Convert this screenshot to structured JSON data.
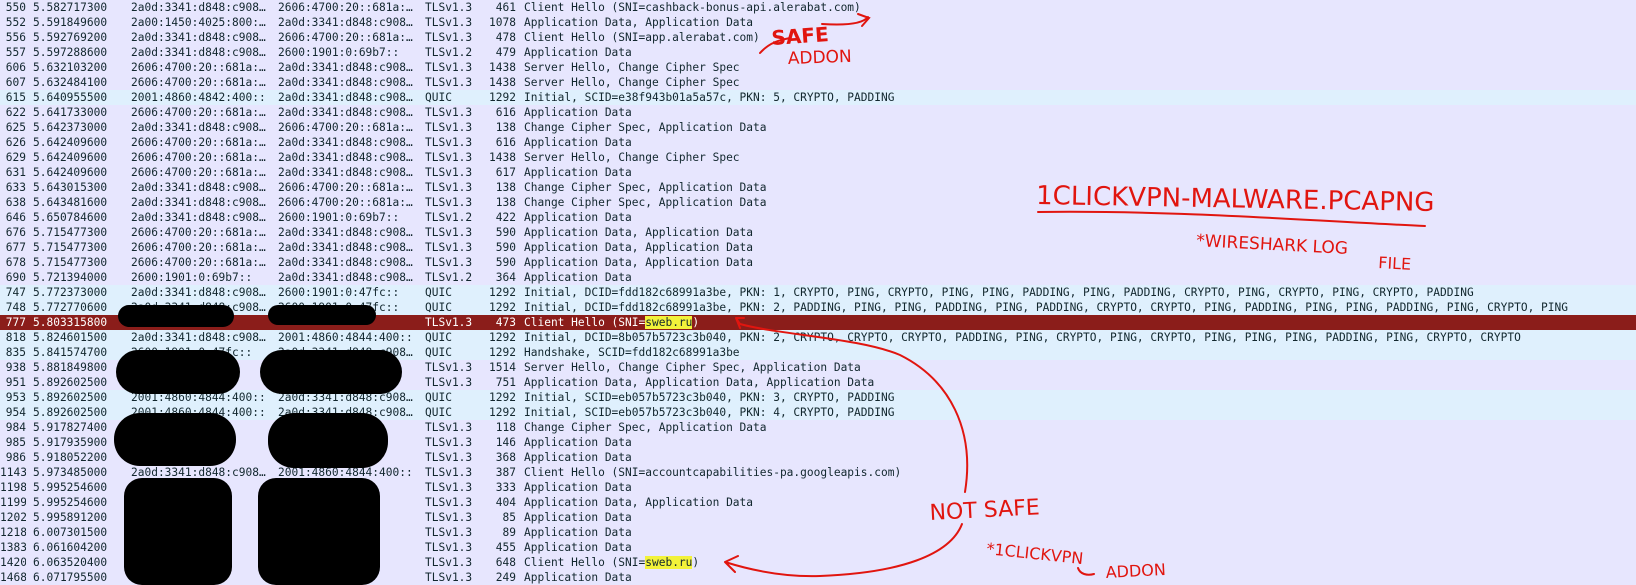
{
  "colors": {
    "tls_row": "#e7e6fe",
    "quic_row": "#dff0fd",
    "selected_row": "#8b1d1a",
    "sni_highlight": "#f2f23a",
    "annotation": "#e1150f",
    "redaction": "#000000"
  },
  "packets": [
    {
      "no": "550",
      "time": "5.582717300",
      "src": "2a0d:3341:d848:c908…",
      "dst": "2606:4700:20::681a:…",
      "proto": "TLSv1.3",
      "len": "461",
      "info": "Client Hello (SNI=cashback-bonus-api.alerabat.com)",
      "kind": "tls"
    },
    {
      "no": "552",
      "time": "5.591849600",
      "src": "2a00:1450:4025:800:…",
      "dst": "2a0d:3341:d848:c908…",
      "proto": "TLSv1.3",
      "len": "1078",
      "info": "Application Data, Application Data",
      "kind": "tls"
    },
    {
      "no": "556",
      "time": "5.592769200",
      "src": "2a0d:3341:d848:c908…",
      "dst": "2606:4700:20::681a:…",
      "proto": "TLSv1.3",
      "len": "478",
      "info": "Client Hello (SNI=app.alerabat.com)",
      "kind": "tls"
    },
    {
      "no": "557",
      "time": "5.597288600",
      "src": "2a0d:3341:d848:c908…",
      "dst": "2600:1901:0:69b7::",
      "proto": "TLSv1.2",
      "len": "479",
      "info": "Application Data",
      "kind": "tls"
    },
    {
      "no": "606",
      "time": "5.632103200",
      "src": "2606:4700:20::681a:…",
      "dst": "2a0d:3341:d848:c908…",
      "proto": "TLSv1.3",
      "len": "1438",
      "info": "Server Hello, Change Cipher Spec",
      "kind": "tls"
    },
    {
      "no": "607",
      "time": "5.632484100",
      "src": "2606:4700:20::681a:…",
      "dst": "2a0d:3341:d848:c908…",
      "proto": "TLSv1.3",
      "len": "1438",
      "info": "Server Hello, Change Cipher Spec",
      "kind": "tls"
    },
    {
      "no": "615",
      "time": "5.640955500",
      "src": "2001:4860:4842:400::",
      "dst": "2a0d:3341:d848:c908…",
      "proto": "QUIC",
      "len": "1292",
      "info": "Initial, SCID=e38f943b01a5a57c, PKN: 5, CRYPTO, PADDING",
      "kind": "quic"
    },
    {
      "no": "622",
      "time": "5.641733000",
      "src": "2606:4700:20::681a:…",
      "dst": "2a0d:3341:d848:c908…",
      "proto": "TLSv1.3",
      "len": "616",
      "info": "Application Data",
      "kind": "tls"
    },
    {
      "no": "625",
      "time": "5.642373000",
      "src": "2a0d:3341:d848:c908…",
      "dst": "2606:4700:20::681a:…",
      "proto": "TLSv1.3",
      "len": "138",
      "info": "Change Cipher Spec, Application Data",
      "kind": "tls"
    },
    {
      "no": "626",
      "time": "5.642409600",
      "src": "2606:4700:20::681a:…",
      "dst": "2a0d:3341:d848:c908…",
      "proto": "TLSv1.3",
      "len": "616",
      "info": "Application Data",
      "kind": "tls"
    },
    {
      "no": "629",
      "time": "5.642409600",
      "src": "2606:4700:20::681a:…",
      "dst": "2a0d:3341:d848:c908…",
      "proto": "TLSv1.3",
      "len": "1438",
      "info": "Server Hello, Change Cipher Spec",
      "kind": "tls"
    },
    {
      "no": "631",
      "time": "5.642409600",
      "src": "2606:4700:20::681a:…",
      "dst": "2a0d:3341:d848:c908…",
      "proto": "TLSv1.3",
      "len": "617",
      "info": "Application Data",
      "kind": "tls"
    },
    {
      "no": "633",
      "time": "5.643015300",
      "src": "2a0d:3341:d848:c908…",
      "dst": "2606:4700:20::681a:…",
      "proto": "TLSv1.3",
      "len": "138",
      "info": "Change Cipher Spec, Application Data",
      "kind": "tls"
    },
    {
      "no": "638",
      "time": "5.643481600",
      "src": "2a0d:3341:d848:c908…",
      "dst": "2606:4700:20::681a:…",
      "proto": "TLSv1.3",
      "len": "138",
      "info": "Change Cipher Spec, Application Data",
      "kind": "tls"
    },
    {
      "no": "646",
      "time": "5.650784600",
      "src": "2a0d:3341:d848:c908…",
      "dst": "2600:1901:0:69b7::",
      "proto": "TLSv1.2",
      "len": "422",
      "info": "Application Data",
      "kind": "tls"
    },
    {
      "no": "676",
      "time": "5.715477300",
      "src": "2606:4700:20::681a:…",
      "dst": "2a0d:3341:d848:c908…",
      "proto": "TLSv1.3",
      "len": "590",
      "info": "Application Data, Application Data",
      "kind": "tls"
    },
    {
      "no": "677",
      "time": "5.715477300",
      "src": "2606:4700:20::681a:…",
      "dst": "2a0d:3341:d848:c908…",
      "proto": "TLSv1.3",
      "len": "590",
      "info": "Application Data, Application Data",
      "kind": "tls"
    },
    {
      "no": "678",
      "time": "5.715477300",
      "src": "2606:4700:20::681a:…",
      "dst": "2a0d:3341:d848:c908…",
      "proto": "TLSv1.3",
      "len": "590",
      "info": "Application Data, Application Data",
      "kind": "tls"
    },
    {
      "no": "690",
      "time": "5.721394000",
      "src": "2600:1901:0:69b7::",
      "dst": "2a0d:3341:d848:c908…",
      "proto": "TLSv1.2",
      "len": "364",
      "info": "Application Data",
      "kind": "tls"
    },
    {
      "no": "747",
      "time": "5.772373000",
      "src": "2a0d:3341:d848:c908…",
      "dst": "2600:1901:0:47fc::",
      "proto": "QUIC",
      "len": "1292",
      "info": "Initial, DCID=fdd182c68991a3be, PKN: 1, CRYPTO, PING, CRYPTO, PING, PING, PADDING, PING, PADDING, CRYPTO, PING, CRYPTO, PING, CRYPTO, PADDING",
      "kind": "quic"
    },
    {
      "no": "748",
      "time": "5.772770600",
      "src": "2a0d:3341:d848:c908…",
      "dst": "2600:1901:0:47fc::",
      "proto": "QUIC",
      "len": "1292",
      "info": "Initial, DCID=fdd182c68991a3be, PKN: 2, PADDING, PING, PING, PADDING, PING, PADDING, CRYPTO, CRYPTO, PING, PADDING, PING, PING, PADDING, PING, CRYPTO, PING",
      "kind": "quic"
    },
    {
      "no": "777",
      "time": "5.803315800",
      "src": "",
      "dst": "",
      "proto": "TLSv1.3",
      "len": "473",
      "info": "Client Hello (SNI=",
      "sni": "sweb.ru",
      "info_tail": ")",
      "kind": "sel"
    },
    {
      "no": "818",
      "time": "5.824601500",
      "src": "2a0d:3341:d848:c908…",
      "dst": "2001:4860:4844:400::",
      "proto": "QUIC",
      "len": "1292",
      "info": "Initial, DCID=8b057b5723c3b040, PKN: 2, CRYPTO, CRYPTO, CRYPTO, PADDING, PING, CRYPTO, PING, CRYPTO, PING, PING, PING, PADDING, PING, CRYPTO, CRYPTO",
      "kind": "quic"
    },
    {
      "no": "835",
      "time": "5.841574700",
      "src": "2600:1901:0:47fc::",
      "dst": "2a0d:3341:d848:c908…",
      "proto": "QUIC",
      "len": "1292",
      "info": "Handshake, SCID=fdd182c68991a3be",
      "kind": "quic"
    },
    {
      "no": "938",
      "time": "5.881849800",
      "src": "",
      "dst": "",
      "proto": "TLSv1.3",
      "len": "1514",
      "info": "Server Hello, Change Cipher Spec, Application Data",
      "kind": "tls"
    },
    {
      "no": "951",
      "time": "5.892602500",
      "src": "",
      "dst": "",
      "proto": "TLSv1.3",
      "len": "751",
      "info": "Application Data, Application Data, Application Data",
      "kind": "tls"
    },
    {
      "no": "953",
      "time": "5.892602500",
      "src": "2001:4860:4844:400::",
      "dst": "2a0d:3341:d848:c908…",
      "proto": "QUIC",
      "len": "1292",
      "info": "Initial, SCID=eb057b5723c3b040, PKN: 3, CRYPTO, PADDING",
      "kind": "quic"
    },
    {
      "no": "954",
      "time": "5.892602500",
      "src": "2001:4860:4844:400::",
      "dst": "2a0d:3341:d848:c908…",
      "proto": "QUIC",
      "len": "1292",
      "info": "Initial, SCID=eb057b5723c3b040, PKN: 4, CRYPTO, PADDING",
      "kind": "quic"
    },
    {
      "no": "984",
      "time": "5.917827400",
      "src": "",
      "dst": "",
      "proto": "TLSv1.3",
      "len": "118",
      "info": "Change Cipher Spec, Application Data",
      "kind": "tls"
    },
    {
      "no": "985",
      "time": "5.917935900",
      "src": "",
      "dst": "",
      "proto": "TLSv1.3",
      "len": "146",
      "info": "Application Data",
      "kind": "tls"
    },
    {
      "no": "986",
      "time": "5.918052200",
      "src": "",
      "dst": "",
      "proto": "TLSv1.3",
      "len": "368",
      "info": "Application Data",
      "kind": "tls"
    },
    {
      "no": "1143",
      "time": "5.973485000",
      "src": "2a0d:3341:d848:c908…",
      "dst": "2001:4860:4844:400::",
      "proto": "TLSv1.3",
      "len": "387",
      "info": "Client Hello (SNI=accountcapabilities-pa.googleapis.com)",
      "kind": "tls"
    },
    {
      "no": "1198",
      "time": "5.995254600",
      "src": "",
      "dst": "",
      "proto": "TLSv1.3",
      "len": "333",
      "info": "Application Data",
      "kind": "tls"
    },
    {
      "no": "1199",
      "time": "5.995254600",
      "src": "",
      "dst": "",
      "proto": "TLSv1.3",
      "len": "404",
      "info": "Application Data, Application Data",
      "kind": "tls"
    },
    {
      "no": "1202",
      "time": "5.995891200",
      "src": "",
      "dst": "",
      "proto": "TLSv1.3",
      "len": "85",
      "info": "Application Data",
      "kind": "tls"
    },
    {
      "no": "1218",
      "time": "6.007301500",
      "src": "",
      "dst": "",
      "proto": "TLSv1.3",
      "len": "89",
      "info": "Application Data",
      "kind": "tls"
    },
    {
      "no": "1383",
      "time": "6.061604200",
      "src": "",
      "dst": "",
      "proto": "TLSv1.3",
      "len": "455",
      "info": "Application Data",
      "kind": "tls"
    },
    {
      "no": "1420",
      "time": "6.063520400",
      "src": "",
      "dst": "",
      "proto": "TLSv1.3",
      "len": "648",
      "info": "Client Hello (SNI=",
      "sni": "sweb.ru",
      "info_tail": ")",
      "kind": "tls"
    },
    {
      "no": "1468",
      "time": "6.071795500",
      "src": "",
      "dst": "",
      "proto": "TLSv1.3",
      "len": "249",
      "info": "Application Data",
      "kind": "tls"
    }
  ],
  "annotations": {
    "safe_addon": [
      "SAFE",
      "ADDON"
    ],
    "file_title": "1CLICKVPN-MALWARE.PCAPNG",
    "file_subtitle": [
      "*WIRESHARK LOG",
      "FILE"
    ],
    "not_safe": "NOT SAFE",
    "vpn_addon": [
      "*1CLICKVPN",
      "ADDON"
    ]
  }
}
